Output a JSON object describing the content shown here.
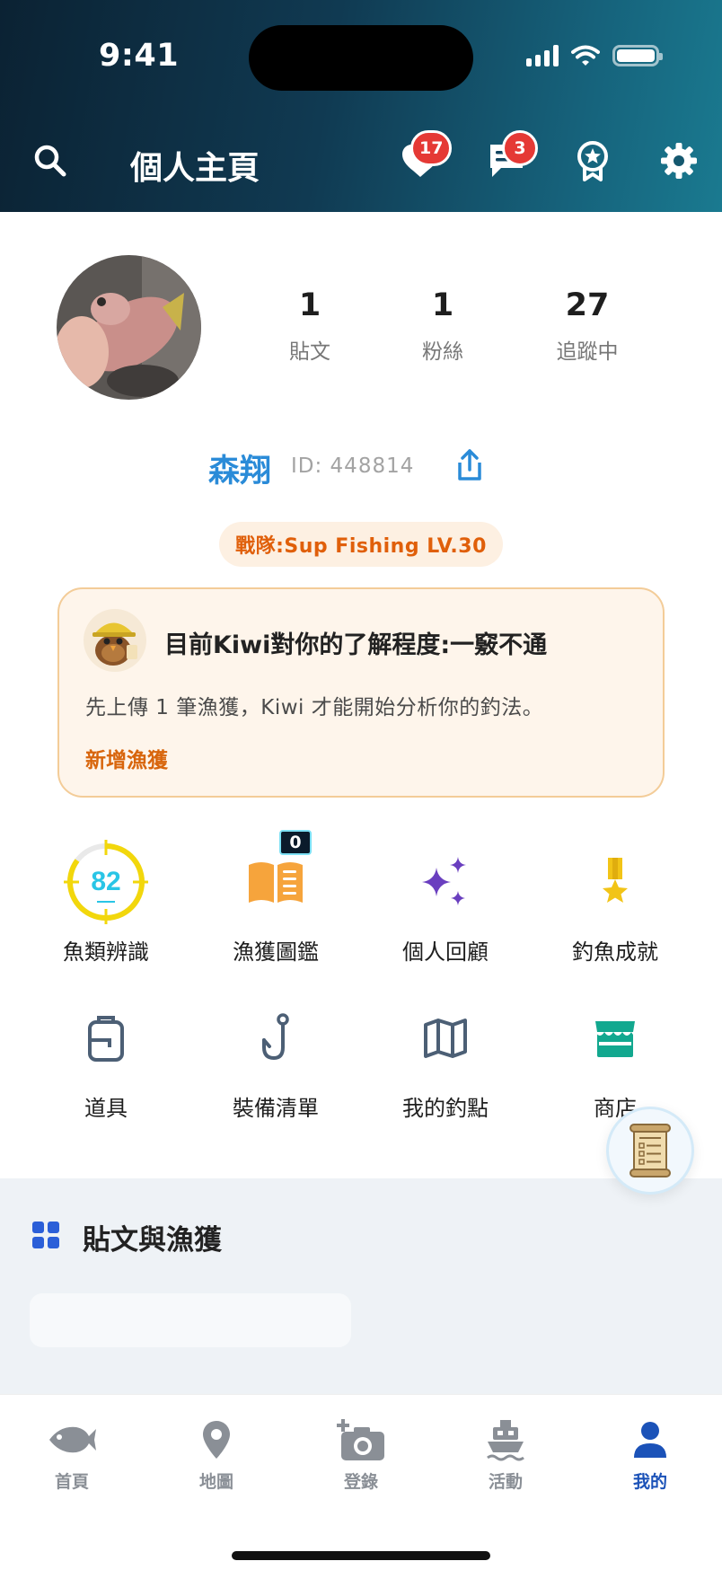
{
  "status_bar": {
    "time": "9:41"
  },
  "header": {
    "title": "個人主頁",
    "badges": {
      "notifications": "17",
      "messages": "3"
    }
  },
  "profile": {
    "stats": [
      {
        "value": "1",
        "label": "貼文"
      },
      {
        "value": "1",
        "label": "粉絲"
      },
      {
        "value": "27",
        "label": "追蹤中"
      }
    ],
    "name": "森翔",
    "id_text": "ID: 448814",
    "team": "戰隊:Sup Fishing LV.30"
  },
  "kiwi_card": {
    "title": "目前Kiwi對你的了解程度:一竅不通",
    "description": "先上傳 1 筆漁獲，Kiwi 才能開始分析你的釣法。",
    "link": "新增漁獲"
  },
  "features": {
    "row1": [
      {
        "label": "魚類辨識",
        "score": "82",
        "icon": "fish-id-gauge-icon"
      },
      {
        "label": "漁獲圖鑑",
        "badge": "0",
        "icon": "open-book-icon"
      },
      {
        "label": "個人回顧",
        "icon": "sparkles-icon"
      },
      {
        "label": "釣魚成就",
        "icon": "medal-icon"
      }
    ],
    "row2": [
      {
        "label": "道具",
        "icon": "backpack-icon"
      },
      {
        "label": "裝備清單",
        "icon": "fish-hook-icon"
      },
      {
        "label": "我的釣點",
        "icon": "map-icon"
      },
      {
        "label": "商店",
        "icon": "storefront-icon"
      }
    ]
  },
  "posts_section": {
    "title": "貼文與漁獲"
  },
  "tabbar": {
    "tabs": [
      {
        "label": "首頁",
        "icon": "fish-icon"
      },
      {
        "label": "地圖",
        "icon": "map-pin-icon"
      },
      {
        "label": "登錄",
        "icon": "camera-plus-icon"
      },
      {
        "label": "活動",
        "icon": "boat-icon"
      },
      {
        "label": "我的",
        "icon": "person-icon",
        "active": true
      }
    ]
  },
  "colors": {
    "accent_blue": "#2a8bd8",
    "active_tab": "#1b52b8",
    "orange": "#e05f0a",
    "badge_red": "#e53935",
    "teal_store": "#12a88f",
    "purple_sparkle": "#6a3fbf"
  }
}
